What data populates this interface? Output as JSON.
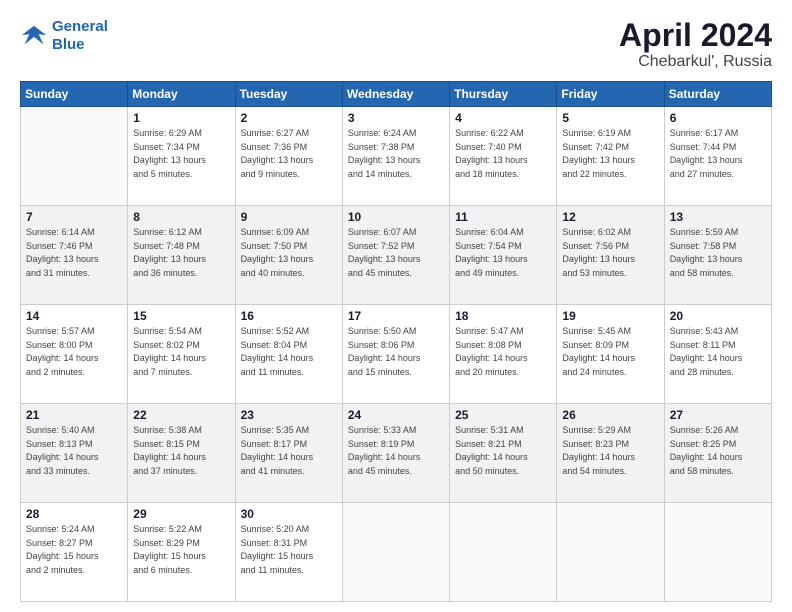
{
  "logo": {
    "line1": "General",
    "line2": "Blue"
  },
  "title": "April 2024",
  "subtitle": "Chebarkul', Russia",
  "weekdays": [
    "Sunday",
    "Monday",
    "Tuesday",
    "Wednesday",
    "Thursday",
    "Friday",
    "Saturday"
  ],
  "weeks": [
    [
      {
        "day": "",
        "info": ""
      },
      {
        "day": "1",
        "info": "Sunrise: 6:29 AM\nSunset: 7:34 PM\nDaylight: 13 hours\nand 5 minutes."
      },
      {
        "day": "2",
        "info": "Sunrise: 6:27 AM\nSunset: 7:36 PM\nDaylight: 13 hours\nand 9 minutes."
      },
      {
        "day": "3",
        "info": "Sunrise: 6:24 AM\nSunset: 7:38 PM\nDaylight: 13 hours\nand 14 minutes."
      },
      {
        "day": "4",
        "info": "Sunrise: 6:22 AM\nSunset: 7:40 PM\nDaylight: 13 hours\nand 18 minutes."
      },
      {
        "day": "5",
        "info": "Sunrise: 6:19 AM\nSunset: 7:42 PM\nDaylight: 13 hours\nand 22 minutes."
      },
      {
        "day": "6",
        "info": "Sunrise: 6:17 AM\nSunset: 7:44 PM\nDaylight: 13 hours\nand 27 minutes."
      }
    ],
    [
      {
        "day": "7",
        "info": "Sunrise: 6:14 AM\nSunset: 7:46 PM\nDaylight: 13 hours\nand 31 minutes."
      },
      {
        "day": "8",
        "info": "Sunrise: 6:12 AM\nSunset: 7:48 PM\nDaylight: 13 hours\nand 36 minutes."
      },
      {
        "day": "9",
        "info": "Sunrise: 6:09 AM\nSunset: 7:50 PM\nDaylight: 13 hours\nand 40 minutes."
      },
      {
        "day": "10",
        "info": "Sunrise: 6:07 AM\nSunset: 7:52 PM\nDaylight: 13 hours\nand 45 minutes."
      },
      {
        "day": "11",
        "info": "Sunrise: 6:04 AM\nSunset: 7:54 PM\nDaylight: 13 hours\nand 49 minutes."
      },
      {
        "day": "12",
        "info": "Sunrise: 6:02 AM\nSunset: 7:56 PM\nDaylight: 13 hours\nand 53 minutes."
      },
      {
        "day": "13",
        "info": "Sunrise: 5:59 AM\nSunset: 7:58 PM\nDaylight: 13 hours\nand 58 minutes."
      }
    ],
    [
      {
        "day": "14",
        "info": "Sunrise: 5:57 AM\nSunset: 8:00 PM\nDaylight: 14 hours\nand 2 minutes."
      },
      {
        "day": "15",
        "info": "Sunrise: 5:54 AM\nSunset: 8:02 PM\nDaylight: 14 hours\nand 7 minutes."
      },
      {
        "day": "16",
        "info": "Sunrise: 5:52 AM\nSunset: 8:04 PM\nDaylight: 14 hours\nand 11 minutes."
      },
      {
        "day": "17",
        "info": "Sunrise: 5:50 AM\nSunset: 8:06 PM\nDaylight: 14 hours\nand 15 minutes."
      },
      {
        "day": "18",
        "info": "Sunrise: 5:47 AM\nSunset: 8:08 PM\nDaylight: 14 hours\nand 20 minutes."
      },
      {
        "day": "19",
        "info": "Sunrise: 5:45 AM\nSunset: 8:09 PM\nDaylight: 14 hours\nand 24 minutes."
      },
      {
        "day": "20",
        "info": "Sunrise: 5:43 AM\nSunset: 8:11 PM\nDaylight: 14 hours\nand 28 minutes."
      }
    ],
    [
      {
        "day": "21",
        "info": "Sunrise: 5:40 AM\nSunset: 8:13 PM\nDaylight: 14 hours\nand 33 minutes."
      },
      {
        "day": "22",
        "info": "Sunrise: 5:38 AM\nSunset: 8:15 PM\nDaylight: 14 hours\nand 37 minutes."
      },
      {
        "day": "23",
        "info": "Sunrise: 5:35 AM\nSunset: 8:17 PM\nDaylight: 14 hours\nand 41 minutes."
      },
      {
        "day": "24",
        "info": "Sunrise: 5:33 AM\nSunset: 8:19 PM\nDaylight: 14 hours\nand 45 minutes."
      },
      {
        "day": "25",
        "info": "Sunrise: 5:31 AM\nSunset: 8:21 PM\nDaylight: 14 hours\nand 50 minutes."
      },
      {
        "day": "26",
        "info": "Sunrise: 5:29 AM\nSunset: 8:23 PM\nDaylight: 14 hours\nand 54 minutes."
      },
      {
        "day": "27",
        "info": "Sunrise: 5:26 AM\nSunset: 8:25 PM\nDaylight: 14 hours\nand 58 minutes."
      }
    ],
    [
      {
        "day": "28",
        "info": "Sunrise: 5:24 AM\nSunset: 8:27 PM\nDaylight: 15 hours\nand 2 minutes."
      },
      {
        "day": "29",
        "info": "Sunrise: 5:22 AM\nSunset: 8:29 PM\nDaylight: 15 hours\nand 6 minutes."
      },
      {
        "day": "30",
        "info": "Sunrise: 5:20 AM\nSunset: 8:31 PM\nDaylight: 15 hours\nand 11 minutes."
      },
      {
        "day": "",
        "info": ""
      },
      {
        "day": "",
        "info": ""
      },
      {
        "day": "",
        "info": ""
      },
      {
        "day": "",
        "info": ""
      }
    ]
  ]
}
